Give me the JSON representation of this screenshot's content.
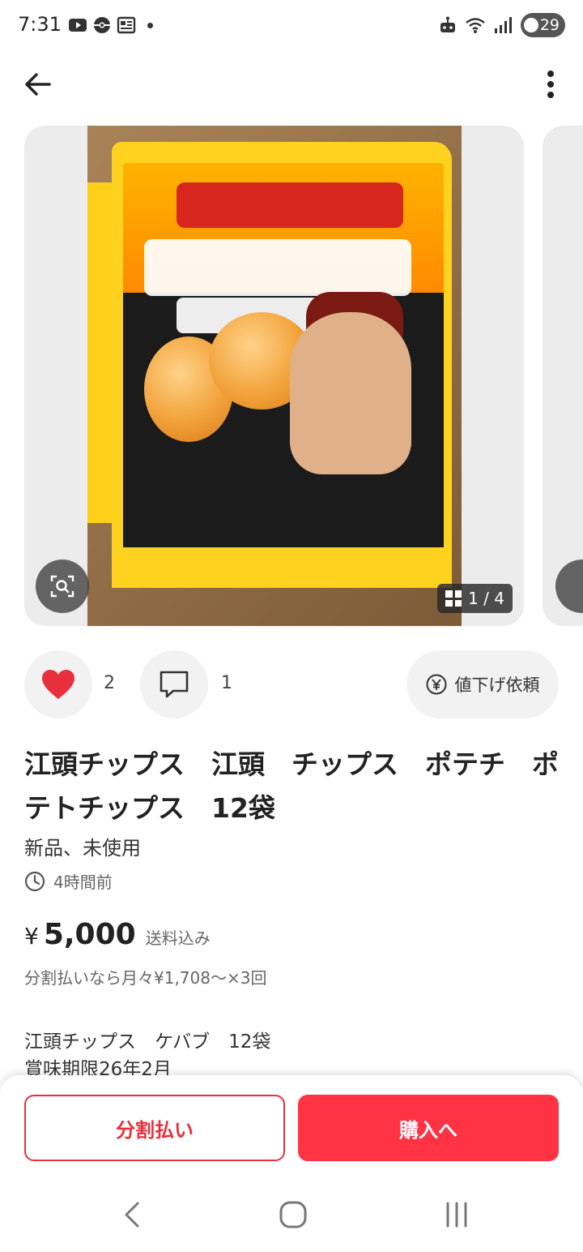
{
  "status_bar": {
    "time": "7:31",
    "left_icons": [
      "youtube-icon",
      "pokeball-icon",
      "news-icon",
      "dot-icon"
    ],
    "right_icons": [
      "robot-icon",
      "wifi-icon",
      "signal-icon",
      "battery-icon"
    ],
    "battery": "29"
  },
  "app_bar": {
    "back_icon": "arrow-left-icon",
    "more_icon": "more-vertical-icon"
  },
  "gallery": {
    "counter": "1 / 4",
    "lens_icon": "image-search-icon",
    "grid_icon": "grid-icon"
  },
  "actions": {
    "like_count": "2",
    "comment_count": "1",
    "offer_label": "値下げ依頼",
    "offer_icon": "yen-circle-icon"
  },
  "item": {
    "title": "江頭チップス　江頭　チップス　ポテチ　ポテトチップス　12袋",
    "condition": "新品、未使用",
    "posted": "4時間前",
    "currency": "¥",
    "price": "5,000",
    "shipping": "送料込み",
    "installment": "分割払いなら月々¥1,708〜×3回",
    "description_line1": "江頭チップス　ケバブ　12袋",
    "description_line2": "賞味期限26年2月"
  },
  "bottom": {
    "installment_label": "分割払い",
    "buy_label": "購入へ"
  },
  "colors": {
    "accent": "#ff3344",
    "heart": "#e8303c"
  }
}
